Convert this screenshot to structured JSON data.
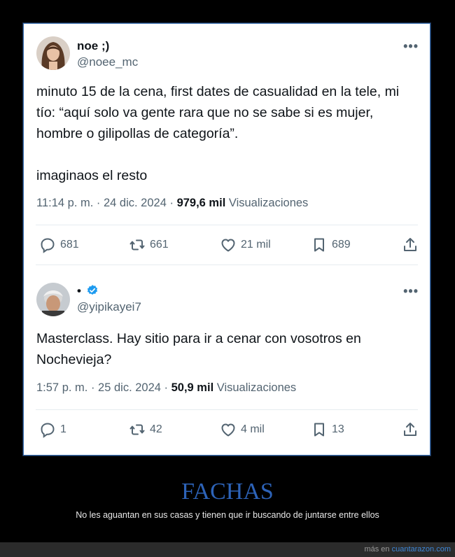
{
  "tweets": [
    {
      "name": "noe ;)",
      "handle": "@noee_mc",
      "more_label": "•••",
      "text_lines": [
        "minuto 15 de la cena, first dates de casualidad en la tele, mi",
        "tío: “aquí solo va gente rara que no se sabe si es mujer,",
        "hombre o gilipollas de categoría”.",
        "",
        "imaginaos el resto"
      ],
      "time": "11:14 p. m. · 24 dic. 2024 · ",
      "views": "979,6 mil",
      "views_label": " Visualizaciones",
      "replies": "681",
      "retweets": "661",
      "likes": "21 mil",
      "bookmarks": "689"
    },
    {
      "name": "•",
      "handle": "@yipikayei7",
      "more_label": "•••",
      "text_lines": [
        "Masterclass. Hay sitio para ir a cenar con vosotros en",
        "Nochevieja?"
      ],
      "time": "1:57 p. m. · 25 dic. 2024 · ",
      "views": "50,9 mil",
      "views_label": " Visualizaciones",
      "replies": "1",
      "retweets": "42",
      "likes": "4 mil",
      "bookmarks": "13"
    }
  ],
  "footer": {
    "title": "FACHAS",
    "subtitle": "No les aguantan en sus casas y tienen que ir buscando de juntarse entre ellos",
    "credit_prefix": "más en ",
    "credit_site": "cuantarazon.com"
  },
  "colors": {
    "footer_title": "#2d63b8",
    "verified": "#1d9bf0",
    "link": "#3d86d6"
  }
}
